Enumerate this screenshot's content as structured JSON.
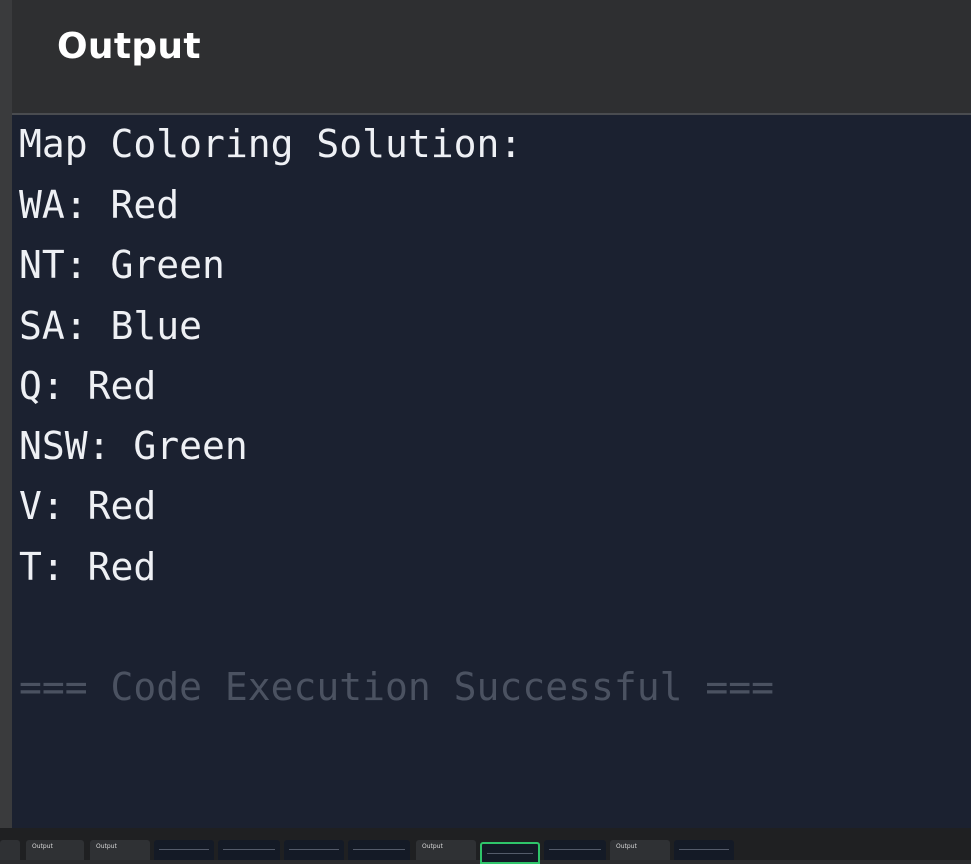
{
  "panel": {
    "title": "Output"
  },
  "console": {
    "lines": [
      "Map Coloring Solution:",
      "WA: Red",
      "NT: Green",
      "SA: Blue",
      "Q: Red",
      "NSW: Green",
      "V: Red",
      "T: Red"
    ],
    "status": "=== Code Execution Successful ==="
  },
  "taskbar": {
    "thumbnails": [
      {
        "label": ""
      },
      {
        "label": "Output"
      },
      {
        "label": "Output"
      },
      {
        "label": ""
      },
      {
        "label": ""
      },
      {
        "label": ""
      },
      {
        "label": ""
      },
      {
        "label": "Output"
      },
      {
        "label": ""
      },
      {
        "label": ""
      },
      {
        "label": "Output"
      },
      {
        "label": ""
      }
    ]
  }
}
